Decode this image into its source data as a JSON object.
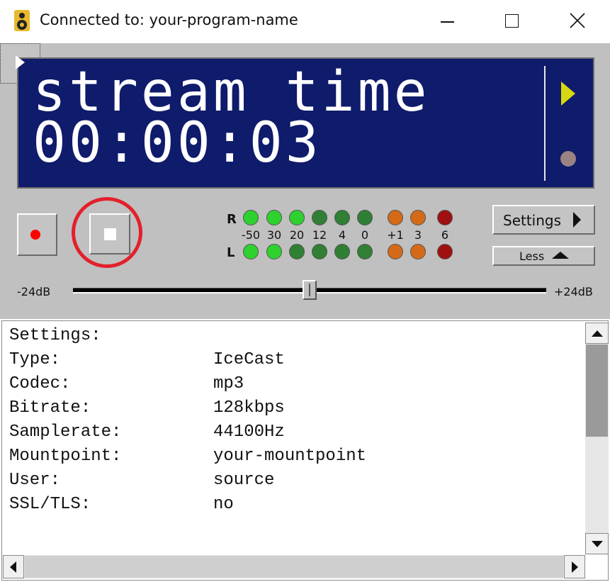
{
  "window": {
    "title": "Connected to: your-program-name"
  },
  "display": {
    "line1": "stream time",
    "line2": "00:00:03",
    "colors": {
      "background": "#0f1b6b",
      "text": "#ffffff",
      "arrow": "#d8d810"
    }
  },
  "transport": {
    "record_icon": "record-dot-icon",
    "stop_icon": "stop-square-icon",
    "play_icon": "play-triangle-icon",
    "highlight_color": "#e3202b"
  },
  "meters": {
    "right_label": "R",
    "left_label": "L",
    "scale": [
      "-50",
      "30",
      "20",
      "12",
      "4",
      "0",
      "+1",
      "3",
      "6"
    ],
    "right_leds": [
      "lit-green",
      "lit-green",
      "lit-green",
      "green",
      "green",
      "green",
      "orange",
      "orange",
      "red"
    ],
    "left_leds": [
      "lit-green",
      "lit-green",
      "green",
      "green",
      "green",
      "green",
      "orange",
      "orange",
      "red"
    ],
    "colors": {
      "lit-green": "#2ed12e",
      "green": "#2f7f34",
      "orange": "#d46a17",
      "red": "#a01010"
    }
  },
  "buttons": {
    "settings_label": "Settings",
    "less_label": "Less"
  },
  "volume": {
    "min_label": "-24dB",
    "max_label": "+24dB",
    "level": 0.5
  },
  "settings_pane": {
    "heading": "Settings:",
    "rows": [
      {
        "key": "Type:",
        "value": "IceCast"
      },
      {
        "key": "Codec:",
        "value": "mp3"
      },
      {
        "key": "Bitrate:",
        "value": "128kbps"
      },
      {
        "key": "Samplerate:",
        "value": "44100Hz"
      },
      {
        "key": "Mountpoint:",
        "value": "your-mountpoint"
      },
      {
        "key": "User:",
        "value": "source"
      },
      {
        "key": "SSL/TLS:",
        "value": "no"
      }
    ]
  }
}
